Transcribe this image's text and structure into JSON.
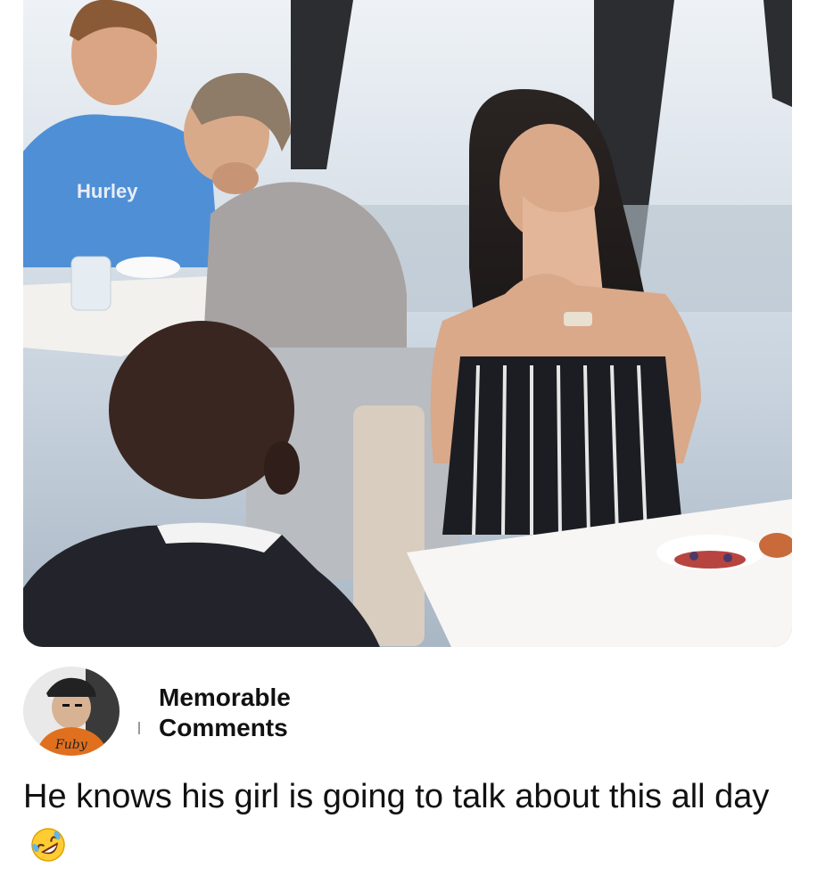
{
  "post": {
    "photo_icon": "photo-image",
    "author": {
      "name": "Memorable Comments",
      "avatar_icon": "avatar-image"
    },
    "caption": "He knows his girl is going to talk about this all day",
    "caption_emoji_icon": "rolling-on-floor-laughing-emoji"
  }
}
